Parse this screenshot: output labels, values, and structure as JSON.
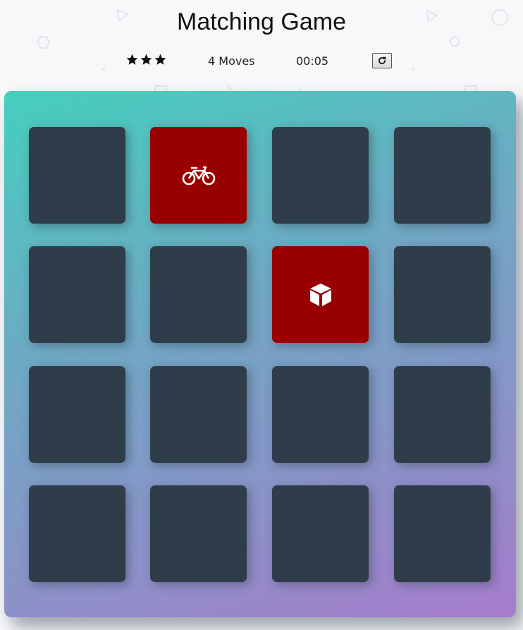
{
  "header": {
    "title": "Matching Game"
  },
  "score_panel": {
    "stars_filled": 3,
    "stars_total": 3,
    "moves_label": "4 Moves",
    "timer": "00:05",
    "restart_icon": "restart-icon"
  },
  "colors": {
    "card_back": "#2e3d49",
    "card_open": "#990000",
    "deck_gradient_start": "#45cfbd",
    "deck_gradient_end": "#a77ccd"
  },
  "cards": [
    {
      "state": "closed",
      "icon": ""
    },
    {
      "state": "open",
      "icon": "bicycle-icon"
    },
    {
      "state": "closed",
      "icon": ""
    },
    {
      "state": "closed",
      "icon": ""
    },
    {
      "state": "closed",
      "icon": ""
    },
    {
      "state": "closed",
      "icon": ""
    },
    {
      "state": "open",
      "icon": "cube-icon"
    },
    {
      "state": "closed",
      "icon": ""
    },
    {
      "state": "closed",
      "icon": ""
    },
    {
      "state": "closed",
      "icon": ""
    },
    {
      "state": "closed",
      "icon": ""
    },
    {
      "state": "closed",
      "icon": ""
    },
    {
      "state": "closed",
      "icon": ""
    },
    {
      "state": "closed",
      "icon": ""
    },
    {
      "state": "closed",
      "icon": ""
    },
    {
      "state": "closed",
      "icon": ""
    }
  ]
}
